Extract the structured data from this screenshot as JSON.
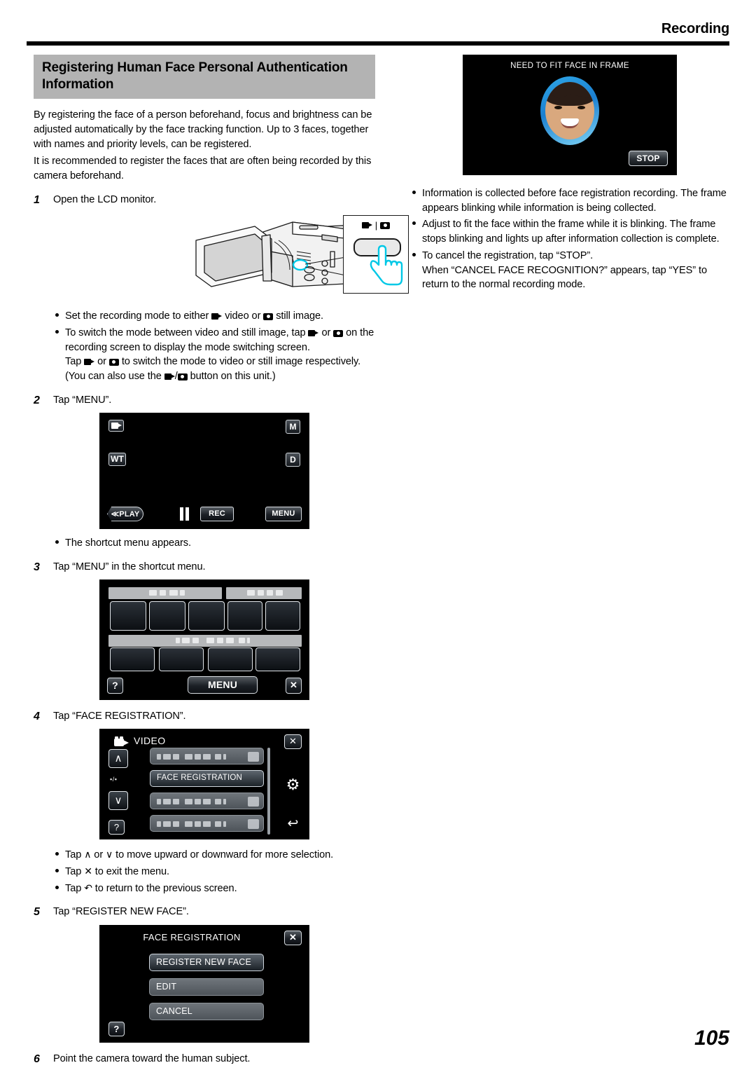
{
  "header": {
    "title": "Recording"
  },
  "page": {
    "number": "105"
  },
  "section": {
    "title": "Registering Human Face Personal Authentication Information",
    "intro1": "By registering the face of a person beforehand, focus and brightness can be adjusted automatically by the face tracking function. Up to 3 faces, together with names and priority levels, can be registered.",
    "intro2": "It is recommended to register the faces that are often being recorded by this camera beforehand."
  },
  "steps": {
    "s1": {
      "num": "1",
      "text": "Open the LCD monitor."
    },
    "s2": {
      "num": "2",
      "text": "Tap “MENU”."
    },
    "s3": {
      "num": "3",
      "text": "Tap “MENU” in the shortcut menu."
    },
    "s4": {
      "num": "4",
      "text": "Tap “FACE REGISTRATION”."
    },
    "s5": {
      "num": "5",
      "text": "Tap “REGISTER NEW FACE”."
    },
    "s6": {
      "num": "6",
      "text": "Point the camera toward the human subject."
    }
  },
  "bullets_step1": {
    "b1_a": "Set the recording mode to either ",
    "b1_b": " video or ",
    "b1_c": " still image.",
    "b2_a": "To switch the mode between video and still image, tap ",
    "b2_b": " or ",
    "b2_c": " on the recording screen to display the mode switching screen.",
    "b2_d": "Tap ",
    "b2_e": " or ",
    "b2_f": " to switch the mode to video or still image respectively.",
    "b2_g": "(You can also use the ",
    "b2_h": "/",
    "b2_i": " button on this unit.)"
  },
  "bullets_step2": {
    "b1": "The shortcut menu appears."
  },
  "bullets_step4": {
    "b1_a": "Tap ",
    "b1_up": "∧",
    "b1_b": " or ",
    "b1_down": "∨",
    "b1_c": " to move upward or downward for more selection.",
    "b2_a": "Tap ",
    "b2_x": "✕",
    "b2_b": " to exit the menu.",
    "b3_a": "Tap ",
    "b3_back": "↶",
    "b3_b": " to return to the previous screen."
  },
  "bullets_right": {
    "b1": "Information is collected before face registration recording. The frame appears blinking while information is being collected.",
    "b2": "Adjust to fit the face within the frame while it is blinking. The frame stops blinking and lights up after information collection is complete.",
    "b3_line1": "To cancel the registration, tap “STOP”.",
    "b3_line2": "When “CANCEL FACE RECOGNITION?” appears, tap “YES” to return to the normal recording mode."
  },
  "screen_face": {
    "title": "NEED TO FIT FACE IN FRAME",
    "stop_label": "STOP"
  },
  "screen_rec": {
    "video_icon": "video-mode-icon",
    "m_label": "M",
    "wt_label": "WT",
    "d_label": "D",
    "play_label": "≪PLAY",
    "rec_label": "REC",
    "menu_label": "MENU"
  },
  "screen_shortcut": {
    "help_label": "?",
    "menu_label": "MENU",
    "close_label": "✕"
  },
  "screen_menu": {
    "heading": "VIDEO",
    "selected_item": "FACE REGISTRATION",
    "close_label": "✕",
    "gear_label": "⚙",
    "back_label": "↩",
    "up_label": "∧",
    "down_label": "∨",
    "help_label": "?",
    "mid_label": "▪/▪"
  },
  "screen_registration": {
    "title": "FACE REGISTRATION",
    "close_label": "✕",
    "help_label": "?",
    "items": [
      {
        "label": "REGISTER NEW FACE",
        "selected": true
      },
      {
        "label": "EDIT",
        "selected": false
      },
      {
        "label": "CANCEL",
        "selected": false
      }
    ]
  },
  "camera_illustration": {
    "callout_video_icon": "video-mode-icon",
    "callout_still_icon": "still-image-icon",
    "callout_divider": "|"
  },
  "colors": {
    "title_band": "#b3b3b3",
    "rule": "#000000",
    "lcd_bg": "#000000",
    "face_ring": "#2fa8e8",
    "highlight": "#00d2e6"
  }
}
